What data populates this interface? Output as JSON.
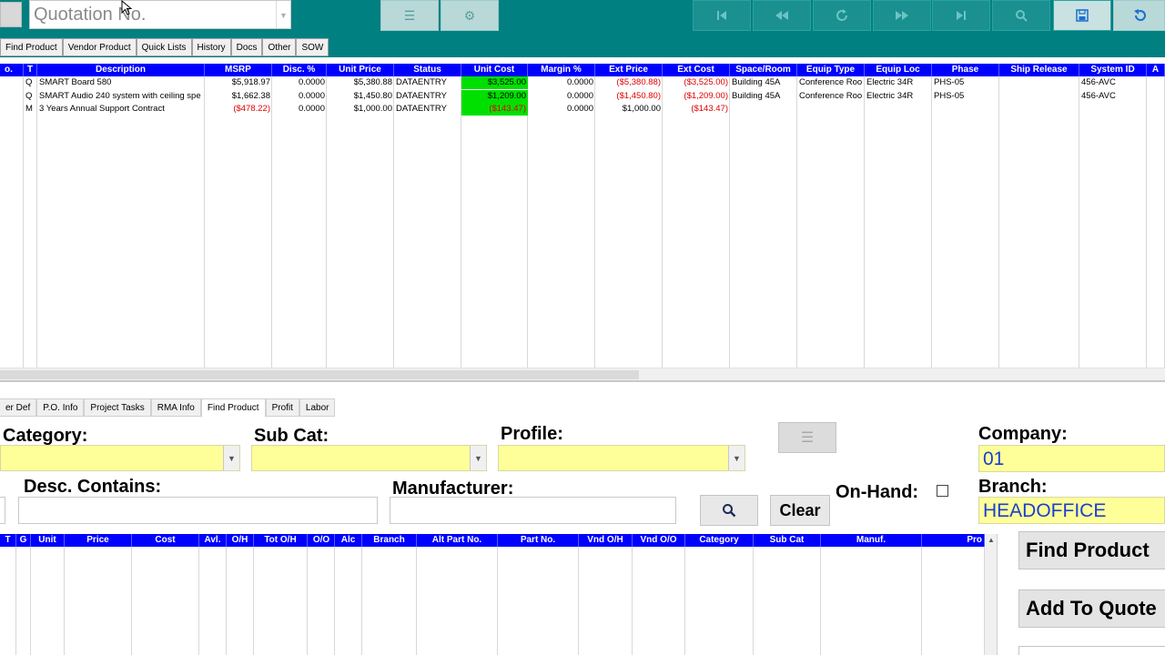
{
  "header": {
    "quotation_placeholder": "Quotation No.",
    "toolbar_icons": [
      "menu-icon",
      "gear-icon",
      "first-record-icon",
      "previous-record-icon",
      "refresh-icon",
      "next-record-icon",
      "last-record-icon",
      "search-icon",
      "save-icon",
      "undo-icon"
    ]
  },
  "top_tabs": [
    "Find Product",
    "Vendor Product",
    "Quick Lists",
    "History",
    "Docs",
    "Other",
    "SOW"
  ],
  "line_grid": {
    "columns": [
      "o.",
      "T",
      "Description",
      "MSRP",
      "Disc. %",
      "Unit Price",
      "Status",
      "Unit Cost",
      "Margin %",
      "Ext Price",
      "Ext Cost",
      "Space/Room",
      "Equip Type",
      "Equip Loc",
      "Phase",
      "Ship Release",
      "System ID",
      "A"
    ],
    "rows": [
      [
        "",
        "Q",
        "SMART Board 580",
        "$5,918.97",
        "0.0000",
        "$5,380.88",
        "DATAENTRY",
        "$3,525.00",
        "0.0000",
        "($5,380.88)",
        "($3,525.00)",
        "Building 45A",
        "Conference Roo",
        "Electric 34R",
        "PHS-05",
        "",
        "456-AVC",
        ""
      ],
      [
        "",
        "Q",
        "SMART Audio 240 system with ceiling spe",
        "$1,662.38",
        "0.0000",
        "$1,450.80",
        "DATAENTRY",
        "$1,209.00",
        "0.0000",
        "($1,450.80)",
        "($1,209.00)",
        "Building 45A",
        "Conference Roo",
        "Electric 34R",
        "PHS-05",
        "",
        "456-AVC",
        ""
      ],
      [
        "",
        "M",
        "3 Years Annual Support Contract",
        "($478.22)",
        "0.0000",
        "$1,000.00",
        "DATAENTRY",
        "($143.47)",
        "0.0000",
        "$1,000.00",
        "($143.47)",
        "",
        "",
        "",
        "",
        "",
        "",
        ""
      ]
    ]
  },
  "bottom_tabs": [
    "er Def",
    "P.O. Info",
    "Project Tasks",
    "RMA Info",
    "Find Product",
    "Profit",
    "Labor"
  ],
  "active_bottom_tab": "Find Product",
  "find_product": {
    "category_label": "Category:",
    "subcat_label": "Sub Cat:",
    "profile_label": "Profile:",
    "company_label": "Company:",
    "company_value": "01",
    "desc_label": "Desc. Contains:",
    "manufacturer_label": "Manufacturer:",
    "clear_label": "Clear",
    "onhand_label": "On-Hand:",
    "branch_label": "Branch:",
    "branch_value": "HEADOFFICE",
    "find_button": "Find Product",
    "add_button": "Add To Quote"
  },
  "product_grid": {
    "columns": [
      "T",
      "G",
      "Unit",
      "Price",
      "Cost",
      "Avl.",
      "O/H",
      "Tot O/H",
      "O/O",
      "Alc",
      "Branch",
      "Alt Part No.",
      "Part No.",
      "Vnd O/H",
      "Vnd O/O",
      "Category",
      "Sub Cat",
      "Manuf.",
      "Pro"
    ]
  },
  "colors": {
    "toolbar": "#008080",
    "grid_header": "#0000ff",
    "highlight_green": "#00e000",
    "negative_red": "#e00000",
    "field_yellow": "#ffff99",
    "field_text_blue": "#1a3fd0"
  }
}
